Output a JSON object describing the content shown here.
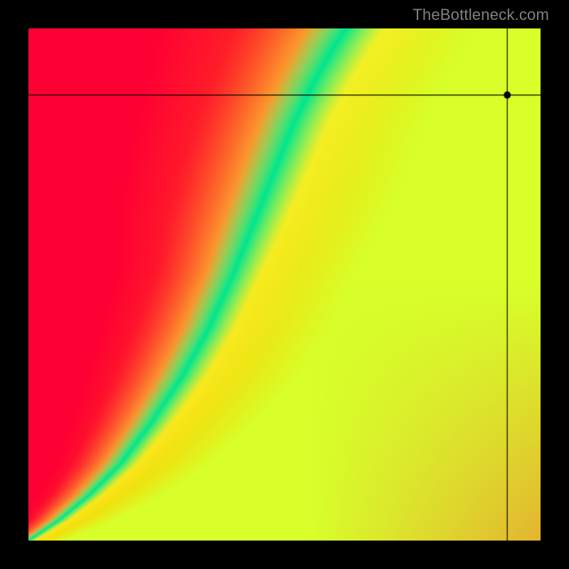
{
  "watermark": "TheBottleneck.com",
  "chart_data": {
    "type": "heatmap",
    "title": "",
    "xlabel": "",
    "ylabel": "",
    "xlim": [
      0,
      1
    ],
    "ylim": [
      0,
      1
    ],
    "grid": false,
    "legend": false,
    "description": "Bottleneck heatmap: color encodes distance from an optimal curve. Green = optimal, yellow = near, orange/red = bottlenecked.",
    "background_gradient": {
      "comment": "Base diagonal gradient from red (bottom/left) to green-yellow (top/right) before ridge compositing",
      "stops": [
        {
          "t": 0.0,
          "color": "#ff0034"
        },
        {
          "t": 0.25,
          "color": "#ff3a1f"
        },
        {
          "t": 0.5,
          "color": "#ff8a00"
        },
        {
          "t": 0.75,
          "color": "#ffcf00"
        },
        {
          "t": 1.0,
          "color": "#d8ff2a"
        }
      ]
    },
    "ridge": {
      "comment": "Green optimal ridge centreline as (x,y) in [0,1] from bottom-left origin; width is approximate half-width of green band in x-units",
      "color_center": "#00e58f",
      "color_halo": "#f8ff3a",
      "points": [
        {
          "x": 0.0,
          "y": 0.0,
          "width": 0.01
        },
        {
          "x": 0.06,
          "y": 0.04,
          "width": 0.015
        },
        {
          "x": 0.12,
          "y": 0.09,
          "width": 0.02
        },
        {
          "x": 0.18,
          "y": 0.15,
          "width": 0.025
        },
        {
          "x": 0.24,
          "y": 0.23,
          "width": 0.03
        },
        {
          "x": 0.3,
          "y": 0.32,
          "width": 0.035
        },
        {
          "x": 0.35,
          "y": 0.41,
          "width": 0.038
        },
        {
          "x": 0.4,
          "y": 0.52,
          "width": 0.04
        },
        {
          "x": 0.44,
          "y": 0.62,
          "width": 0.045
        },
        {
          "x": 0.48,
          "y": 0.72,
          "width": 0.048
        },
        {
          "x": 0.52,
          "y": 0.82,
          "width": 0.05
        },
        {
          "x": 0.56,
          "y": 0.9,
          "width": 0.052
        },
        {
          "x": 0.6,
          "y": 0.97,
          "width": 0.055
        },
        {
          "x": 0.62,
          "y": 1.0,
          "width": 0.056
        }
      ]
    },
    "marker": {
      "comment": "Black crosshair point in chart-normalized coords (0,0 = bottom-left)",
      "x": 0.935,
      "y": 0.87,
      "color": "#000000",
      "radius_px": 5
    }
  }
}
